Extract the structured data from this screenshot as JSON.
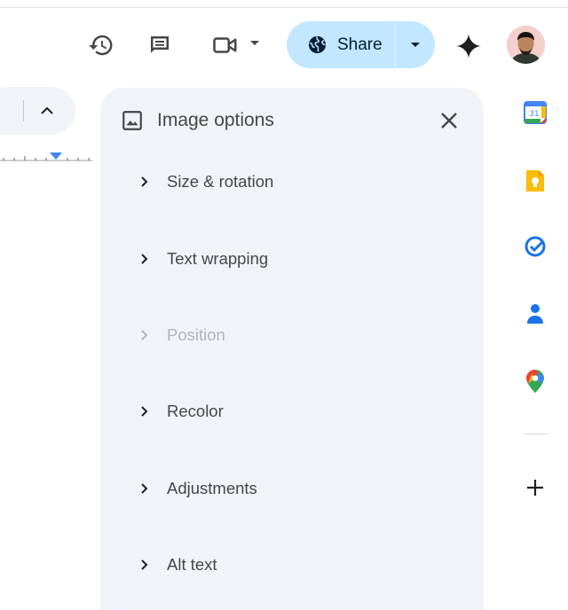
{
  "toolbar": {
    "icons": [
      "history-icon",
      "comment-icon",
      "video-meet-icon",
      "dropdown-arrow-icon",
      "gemini-icon"
    ],
    "share_label": "Share",
    "accent": "#c2e7ff"
  },
  "panel": {
    "title": "Image options",
    "options": [
      {
        "label": "Size & rotation",
        "enabled": true
      },
      {
        "label": "Text wrapping",
        "enabled": true
      },
      {
        "label": "Position",
        "enabled": false
      },
      {
        "label": "Recolor",
        "enabled": true
      },
      {
        "label": "Adjustments",
        "enabled": true
      },
      {
        "label": "Alt text",
        "enabled": true
      }
    ]
  },
  "rail": {
    "calendar_day": "31",
    "apps": [
      "calendar-icon",
      "keep-icon",
      "tasks-icon",
      "contacts-icon",
      "maps-icon",
      "add-icon"
    ]
  }
}
